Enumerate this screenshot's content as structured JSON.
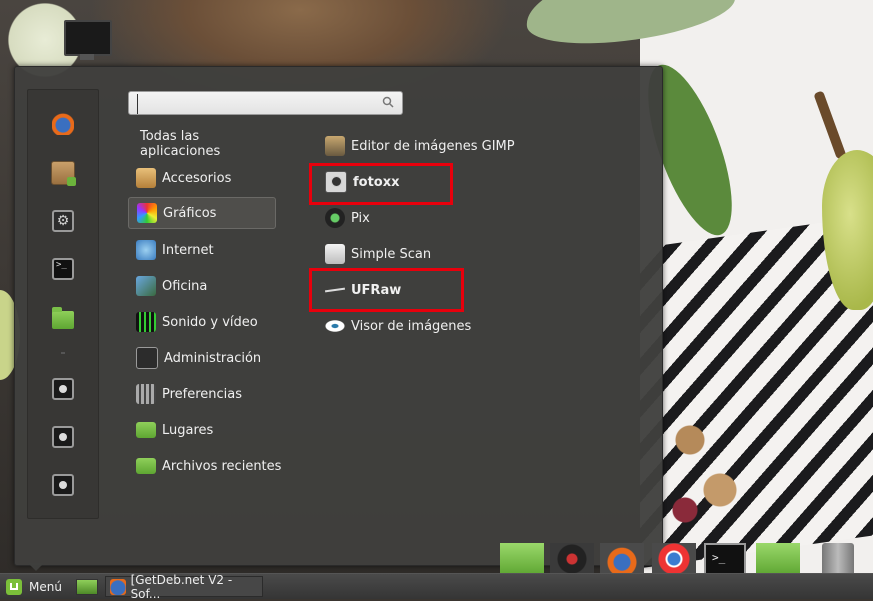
{
  "search": {
    "placeholder": "",
    "value": ""
  },
  "categories": [
    {
      "label": "Todas las aplicaciones",
      "icon": "none"
    },
    {
      "label": "Accesorios",
      "icon": "calculator-icon"
    },
    {
      "label": "Gráficos",
      "icon": "color-palette-icon",
      "selected": true
    },
    {
      "label": "Internet",
      "icon": "globe-icon"
    },
    {
      "label": "Oficina",
      "icon": "office-icon"
    },
    {
      "label": "Sonido y vídeo",
      "icon": "film-icon"
    },
    {
      "label": "Administración",
      "icon": "admin-icon"
    },
    {
      "label": "Preferencias",
      "icon": "sliders-icon"
    },
    {
      "label": "Lugares",
      "icon": "folder-icon"
    },
    {
      "label": "Archivos recientes",
      "icon": "recent-folder-icon"
    }
  ],
  "apps": [
    {
      "label": "Editor de imágenes GIMP",
      "icon": "gimp-icon"
    },
    {
      "label": "fotoxx",
      "icon": "camera-icon",
      "highlighted": true
    },
    {
      "label": "Pix",
      "icon": "pix-icon"
    },
    {
      "label": "Simple Scan",
      "icon": "scanner-icon"
    },
    {
      "label": "UFRaw",
      "icon": "ufraw-icon",
      "highlighted": true
    },
    {
      "label": "Visor de imágenes",
      "icon": "eye-icon"
    }
  ],
  "favorites": [
    "firefox-icon",
    "package-manager-icon",
    "system-settings-icon",
    "terminal-icon",
    "files-icon",
    "lock-screen-icon",
    "logout-icon",
    "power-icon"
  ],
  "taskbar": {
    "menu_label": "Menú",
    "window_title": "[GetDeb.net V2 - Sof..."
  },
  "dock": {
    "terminal_prompt": ">_"
  },
  "colors": {
    "highlight": "#e8000c",
    "menu_bg": "#403f3d",
    "mint_green": "#7bbf3a"
  }
}
